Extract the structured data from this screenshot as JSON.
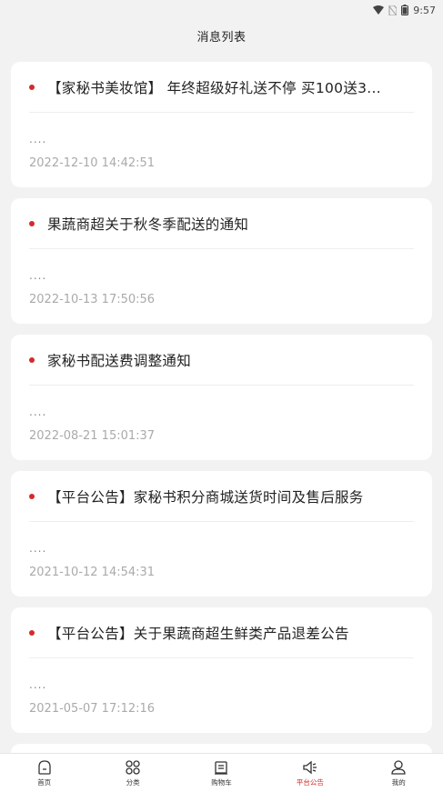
{
  "status_bar": {
    "time": "9:57"
  },
  "header": {
    "title": "消息列表"
  },
  "messages": [
    {
      "title": "【家秘书美妆馆】 年终超级好礼送不停 买100送3...",
      "preview": "....",
      "time": "2022-12-10 14:42:51"
    },
    {
      "title": "果蔬商超关于秋冬季配送的通知",
      "preview": "....",
      "time": "2022-10-13 17:50:56"
    },
    {
      "title": "家秘书配送费调整通知",
      "preview": "....",
      "time": "2022-08-21 15:01:37"
    },
    {
      "title": "【平台公告】家秘书积分商城送货时间及售后服务",
      "preview": "....",
      "time": "2021-10-12 14:54:31"
    },
    {
      "title": "【平台公告】关于果蔬商超生鲜类产品退差公告",
      "preview": "....",
      "time": "2021-05-07 17:12:16"
    }
  ],
  "tabbar": {
    "items": [
      {
        "label": "首页",
        "icon": "home-icon"
      },
      {
        "label": "分类",
        "icon": "category-grid-icon"
      },
      {
        "label": "购物车",
        "icon": "cart-icon"
      },
      {
        "label": "平台公告",
        "icon": "megaphone-icon",
        "active": true
      },
      {
        "label": "我的",
        "icon": "profile-icon"
      }
    ],
    "active_color": "#d42a2a"
  },
  "colors": {
    "accent": "#d42a2a",
    "background": "#f2f2f2"
  }
}
